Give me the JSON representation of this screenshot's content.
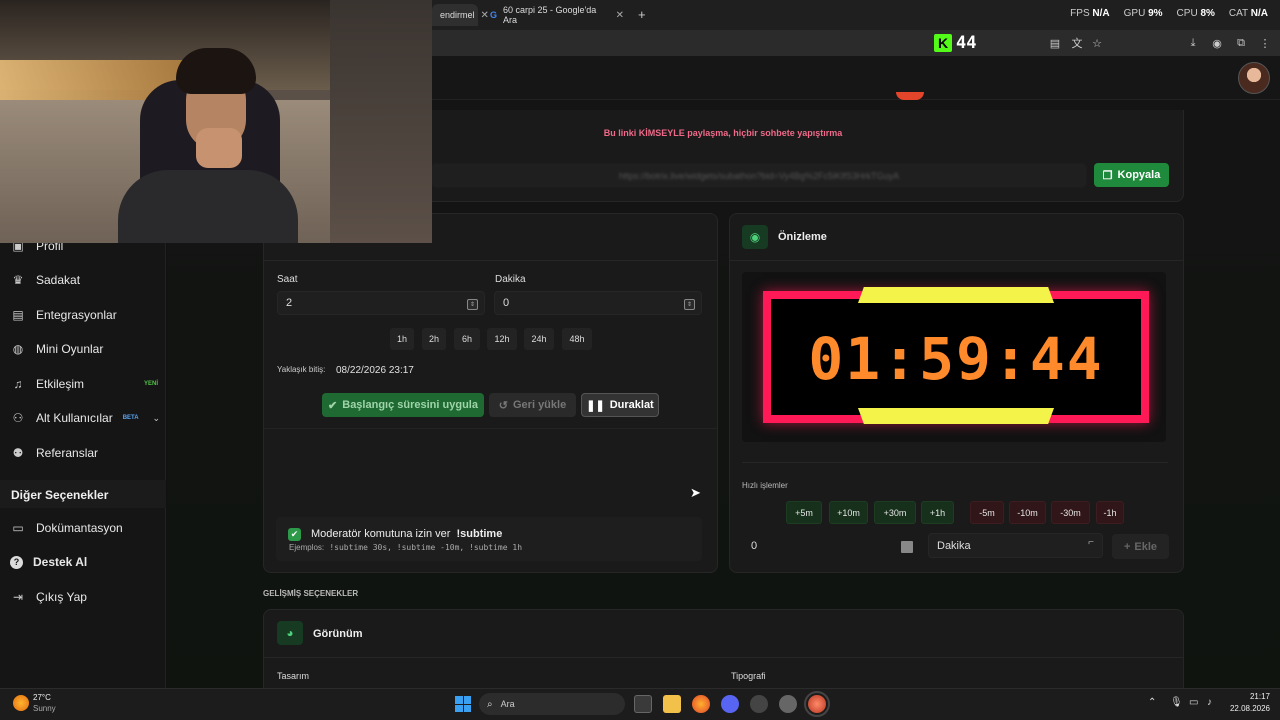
{
  "browser": {
    "tabs": [
      {
        "label": "endirmel"
      },
      {
        "label": "60 carpi 25 - Google'da Ara"
      }
    ],
    "perf": {
      "fps_label": "FPS",
      "fps": "N/A",
      "gpu_label": "GPU",
      "gpu": "9%",
      "cpu_label": "CPU",
      "cpu": "8%",
      "cat_label": "CAT",
      "cat": "N/A"
    },
    "kick_count": "44"
  },
  "share": {
    "warning": "Bu linki KİMSEYLE paylaşma, hiçbir sohbete yapıştırma",
    "url": "https://botrix.live/widgets/subathon?bid=Vy4Bg%2Fc5iKIfS3HrkTGuyA",
    "copy_label": "Kopyala"
  },
  "sidebar": {
    "items": [
      {
        "label": "Profil",
        "icon": "id-card-icon"
      },
      {
        "label": "Sadakat",
        "icon": "trophy-icon"
      },
      {
        "label": "Entegrasyonlar",
        "icon": "plug-icon"
      },
      {
        "label": "Mini Oyunlar",
        "icon": "gamepad-icon"
      },
      {
        "label": "Etkileşim",
        "icon": "music-icon",
        "badge": "YENİ"
      },
      {
        "label": "Alt Kullanıcılar",
        "icon": "users-icon",
        "badge": "BETA"
      },
      {
        "label": "Referanslar",
        "icon": "user-group-icon"
      }
    ],
    "section_title": "Diğer Seçenekler",
    "other_items": [
      {
        "label": "Dokümantasyon",
        "icon": "doc-icon"
      },
      {
        "label": "Destek Al",
        "icon": "question-icon"
      },
      {
        "label": "Çıkış Yap",
        "icon": "logout-icon"
      }
    ]
  },
  "settings": {
    "hour_label": "Saat",
    "hour_value": "2",
    "minute_label": "Dakika",
    "minute_value": "0",
    "presets": [
      "1h",
      "2h",
      "6h",
      "12h",
      "24h",
      "48h"
    ],
    "end_label": "Yaklaşık bitiş:",
    "end_value": "08/22/2026 23:17",
    "apply_label": "Başlangıç süresini uygula",
    "reset_label": "Geri yükle",
    "pause_label": "Duraklat",
    "mod_label": "Moderatör komutuna izin ver",
    "mod_command": "!subtime",
    "examples_label": "Ejemplos:",
    "examples": "!subtime 30s, !subtime -10m, !subtime 1h"
  },
  "preview": {
    "title": "Önizleme",
    "timer": "01:59:44",
    "quick_label": "Hızlı işlemler",
    "plus": [
      "+5m",
      "+10m",
      "+30m",
      "+1h"
    ],
    "minus": [
      "-5m",
      "-10m",
      "-30m",
      "-1h"
    ],
    "amount_value": "0",
    "unit_value": "Dakika",
    "add_label": "Ekle"
  },
  "advanced": {
    "section_label": "GELİŞMİŞ SEÇENEKLER",
    "appearance_title": "Görünüm",
    "design_label": "Tasarım",
    "typography_label": "Tipografi"
  },
  "taskbar": {
    "weather_temp": "27°C",
    "weather_desc": "Sunny",
    "search_placeholder": "Ara",
    "time": "21:17",
    "date": "22.08.2026"
  },
  "colors": {
    "accent_green": "#1f8a3b",
    "timer_border": "#ff1a57",
    "timer_digits": "#ff8a2b",
    "timer_bars": "#f4f34a"
  }
}
